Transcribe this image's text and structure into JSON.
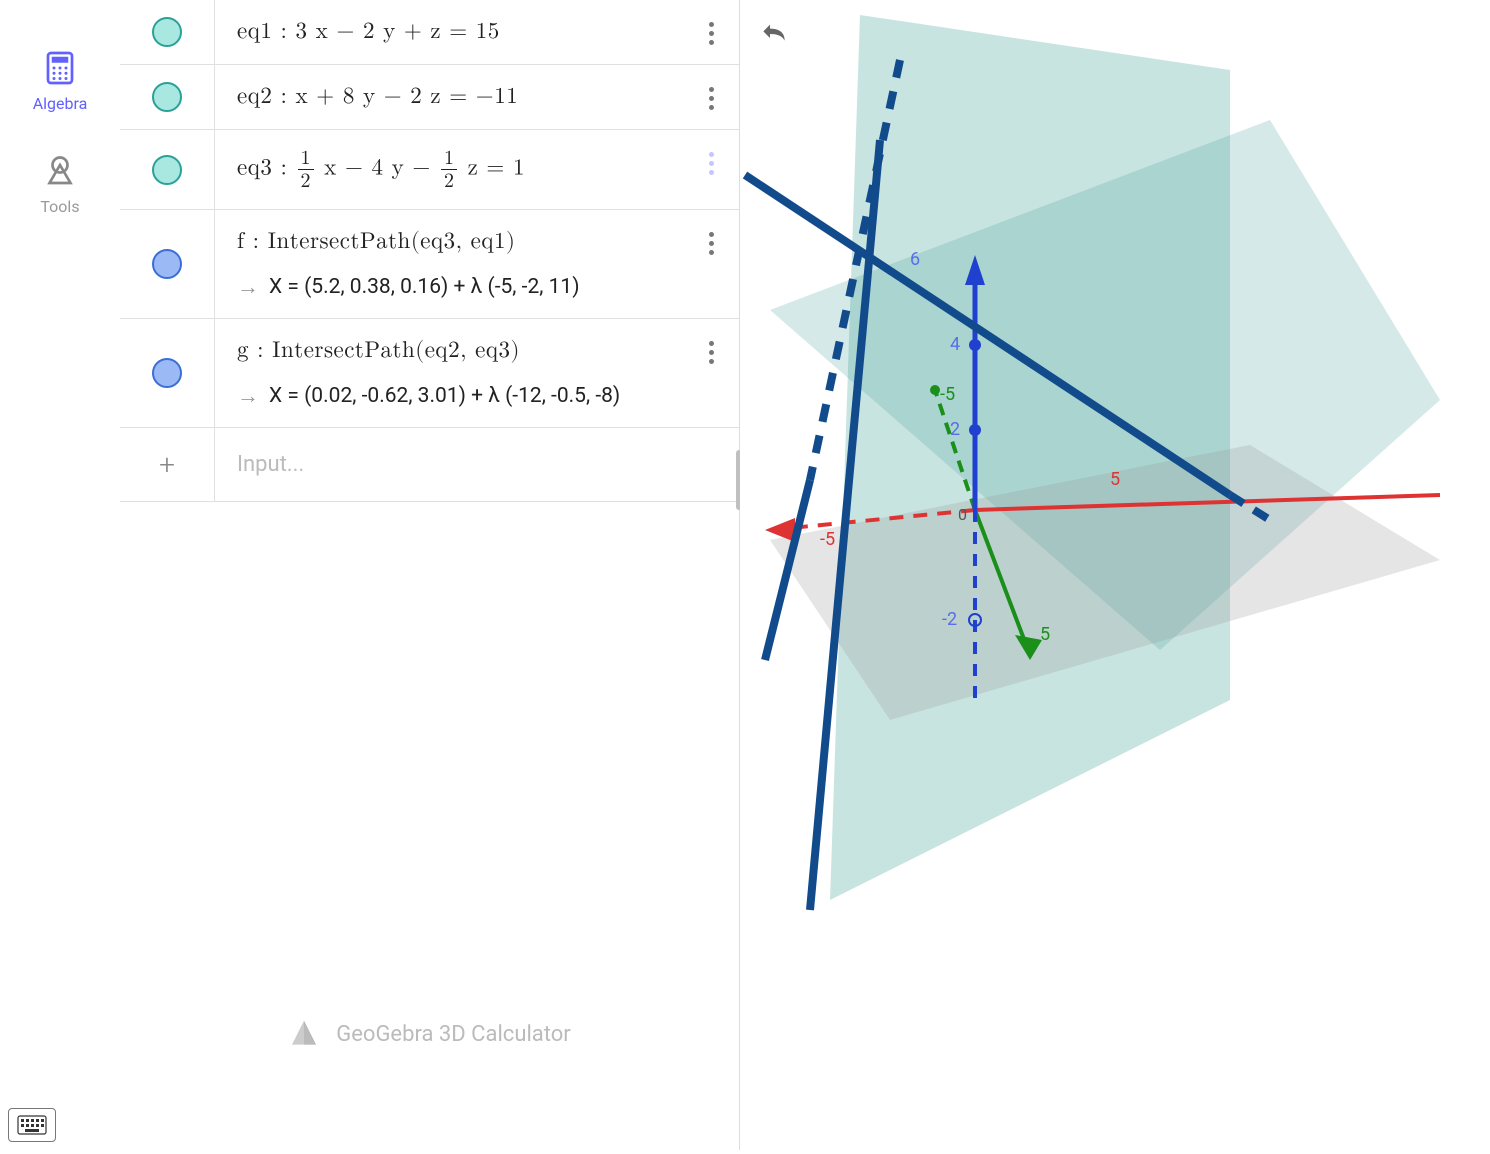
{
  "nav": {
    "algebra": "Algebra",
    "tools": "Tools"
  },
  "rows": [
    {
      "label": "eq1",
      "expr": "3 x − 2 y + z  =  15",
      "color": "teal"
    },
    {
      "label": "eq2",
      "expr": "x + 8 y − 2 z  =  −11",
      "color": "teal"
    },
    {
      "label": "eq3",
      "color": "teal",
      "frac1_num": "1",
      "frac1_den": "2",
      "mid": " x − 4 y − ",
      "frac2_num": "1",
      "frac2_den": "2",
      "tail": "  z  =  1"
    },
    {
      "label": "f",
      "expr": "IntersectPath(eq3, eq1)",
      "result": "X = (5.2, 0.38, 0.16) + λ (-5, -2, 11)",
      "color": "blue"
    },
    {
      "label": "g",
      "expr": "IntersectPath(eq2, eq3)",
      "result": "X = (0.02, -0.62, 3.01) + λ (-12, -0.5, -8)",
      "color": "blue"
    }
  ],
  "input_placeholder": "Input...",
  "brand": "GeoGebra 3D Calculator",
  "axis_labels": {
    "z6": "6",
    "z4": "4",
    "z2": "2",
    "zn2": "-2",
    "yn5": "-5",
    "y5": "5",
    "xn5": "-5",
    "x5": "5",
    "origin": "0"
  }
}
